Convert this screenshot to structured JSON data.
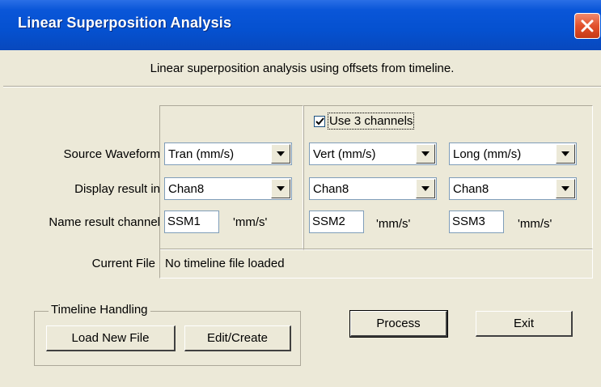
{
  "window": {
    "title": "Linear Superposition Analysis",
    "subtitle": "Linear superposition analysis using offsets from timeline."
  },
  "use_3_channels": {
    "label": "Use 3 channels",
    "checked": true
  },
  "row_labels": {
    "source_waveform": "Source Waveform",
    "display_result_in": "Display result in",
    "name_result_channel": "Name result channel",
    "current_file": "Current File"
  },
  "channels": [
    {
      "source": "Tran (mm/s)",
      "display": "Chan8",
      "name": "SSM1",
      "unit": "'mm/s'"
    },
    {
      "source": "Vert (mm/s)",
      "display": "Chan8",
      "name": "SSM2",
      "unit": "'mm/s'"
    },
    {
      "source": "Long (mm/s)",
      "display": "Chan8",
      "name": "SSM3",
      "unit": "'mm/s'"
    }
  ],
  "current_file_value": "No timeline file loaded",
  "timeline_handling": {
    "legend": "Timeline Handling",
    "load_button": "Load New File",
    "edit_button": "Edit/Create"
  },
  "buttons": {
    "process": "Process",
    "exit": "Exit"
  },
  "colors": {
    "titlebar": "#0551d0",
    "face": "#ece9d8",
    "close": "#e2502b"
  },
  "icons": {
    "close": "close-icon",
    "dropdown": "chevron-down-icon",
    "check": "checkmark-icon"
  }
}
